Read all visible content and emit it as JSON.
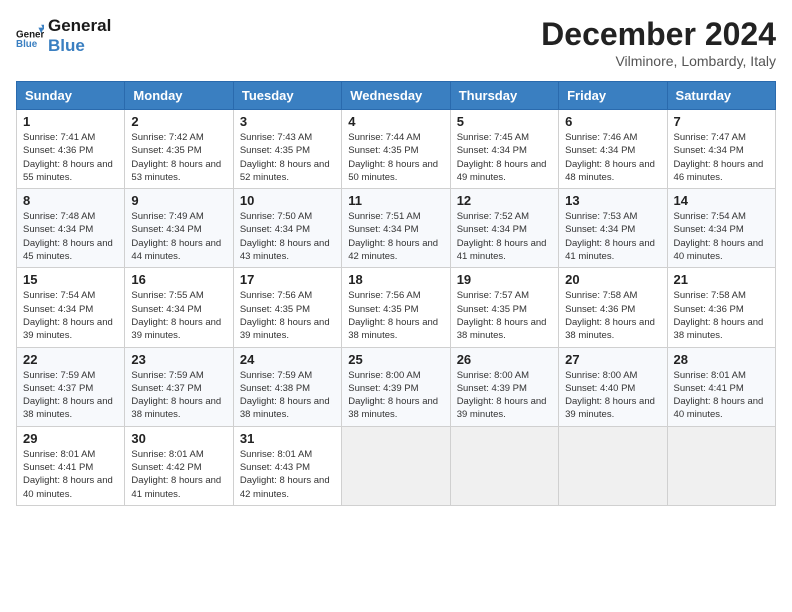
{
  "header": {
    "logo_line1": "General",
    "logo_line2": "Blue",
    "month_title": "December 2024",
    "location": "Vilminore, Lombardy, Italy"
  },
  "days_of_week": [
    "Sunday",
    "Monday",
    "Tuesday",
    "Wednesday",
    "Thursday",
    "Friday",
    "Saturday"
  ],
  "weeks": [
    [
      {
        "day": "1",
        "sunrise": "7:41 AM",
        "sunset": "4:36 PM",
        "daylight": "8 hours and 55 minutes."
      },
      {
        "day": "2",
        "sunrise": "7:42 AM",
        "sunset": "4:35 PM",
        "daylight": "8 hours and 53 minutes."
      },
      {
        "day": "3",
        "sunrise": "7:43 AM",
        "sunset": "4:35 PM",
        "daylight": "8 hours and 52 minutes."
      },
      {
        "day": "4",
        "sunrise": "7:44 AM",
        "sunset": "4:35 PM",
        "daylight": "8 hours and 50 minutes."
      },
      {
        "day": "5",
        "sunrise": "7:45 AM",
        "sunset": "4:34 PM",
        "daylight": "8 hours and 49 minutes."
      },
      {
        "day": "6",
        "sunrise": "7:46 AM",
        "sunset": "4:34 PM",
        "daylight": "8 hours and 48 minutes."
      },
      {
        "day": "7",
        "sunrise": "7:47 AM",
        "sunset": "4:34 PM",
        "daylight": "8 hours and 46 minutes."
      }
    ],
    [
      {
        "day": "8",
        "sunrise": "7:48 AM",
        "sunset": "4:34 PM",
        "daylight": "8 hours and 45 minutes."
      },
      {
        "day": "9",
        "sunrise": "7:49 AM",
        "sunset": "4:34 PM",
        "daylight": "8 hours and 44 minutes."
      },
      {
        "day": "10",
        "sunrise": "7:50 AM",
        "sunset": "4:34 PM",
        "daylight": "8 hours and 43 minutes."
      },
      {
        "day": "11",
        "sunrise": "7:51 AM",
        "sunset": "4:34 PM",
        "daylight": "8 hours and 42 minutes."
      },
      {
        "day": "12",
        "sunrise": "7:52 AM",
        "sunset": "4:34 PM",
        "daylight": "8 hours and 41 minutes."
      },
      {
        "day": "13",
        "sunrise": "7:53 AM",
        "sunset": "4:34 PM",
        "daylight": "8 hours and 41 minutes."
      },
      {
        "day": "14",
        "sunrise": "7:54 AM",
        "sunset": "4:34 PM",
        "daylight": "8 hours and 40 minutes."
      }
    ],
    [
      {
        "day": "15",
        "sunrise": "7:54 AM",
        "sunset": "4:34 PM",
        "daylight": "8 hours and 39 minutes."
      },
      {
        "day": "16",
        "sunrise": "7:55 AM",
        "sunset": "4:34 PM",
        "daylight": "8 hours and 39 minutes."
      },
      {
        "day": "17",
        "sunrise": "7:56 AM",
        "sunset": "4:35 PM",
        "daylight": "8 hours and 39 minutes."
      },
      {
        "day": "18",
        "sunrise": "7:56 AM",
        "sunset": "4:35 PM",
        "daylight": "8 hours and 38 minutes."
      },
      {
        "day": "19",
        "sunrise": "7:57 AM",
        "sunset": "4:35 PM",
        "daylight": "8 hours and 38 minutes."
      },
      {
        "day": "20",
        "sunrise": "7:58 AM",
        "sunset": "4:36 PM",
        "daylight": "8 hours and 38 minutes."
      },
      {
        "day": "21",
        "sunrise": "7:58 AM",
        "sunset": "4:36 PM",
        "daylight": "8 hours and 38 minutes."
      }
    ],
    [
      {
        "day": "22",
        "sunrise": "7:59 AM",
        "sunset": "4:37 PM",
        "daylight": "8 hours and 38 minutes."
      },
      {
        "day": "23",
        "sunrise": "7:59 AM",
        "sunset": "4:37 PM",
        "daylight": "8 hours and 38 minutes."
      },
      {
        "day": "24",
        "sunrise": "7:59 AM",
        "sunset": "4:38 PM",
        "daylight": "8 hours and 38 minutes."
      },
      {
        "day": "25",
        "sunrise": "8:00 AM",
        "sunset": "4:39 PM",
        "daylight": "8 hours and 38 minutes."
      },
      {
        "day": "26",
        "sunrise": "8:00 AM",
        "sunset": "4:39 PM",
        "daylight": "8 hours and 39 minutes."
      },
      {
        "day": "27",
        "sunrise": "8:00 AM",
        "sunset": "4:40 PM",
        "daylight": "8 hours and 39 minutes."
      },
      {
        "day": "28",
        "sunrise": "8:01 AM",
        "sunset": "4:41 PM",
        "daylight": "8 hours and 40 minutes."
      }
    ],
    [
      {
        "day": "29",
        "sunrise": "8:01 AM",
        "sunset": "4:41 PM",
        "daylight": "8 hours and 40 minutes."
      },
      {
        "day": "30",
        "sunrise": "8:01 AM",
        "sunset": "4:42 PM",
        "daylight": "8 hours and 41 minutes."
      },
      {
        "day": "31",
        "sunrise": "8:01 AM",
        "sunset": "4:43 PM",
        "daylight": "8 hours and 42 minutes."
      },
      null,
      null,
      null,
      null
    ]
  ],
  "labels": {
    "sunrise_prefix": "Sunrise: ",
    "sunset_prefix": "Sunset: ",
    "daylight_prefix": "Daylight: "
  }
}
